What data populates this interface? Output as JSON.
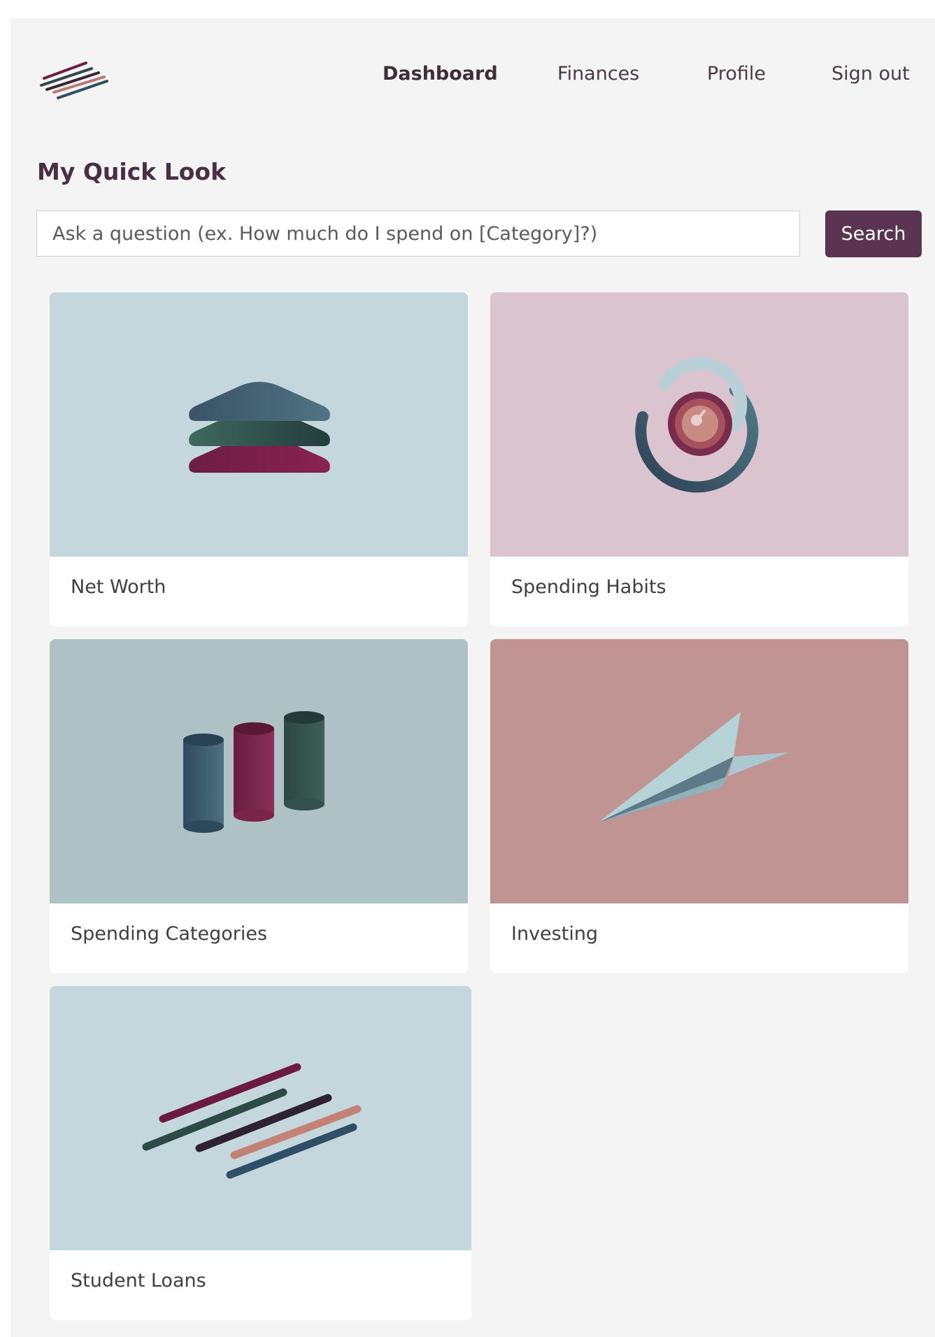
{
  "nav": {
    "dashboard": "Dashboard",
    "finances": "Finances",
    "profile": "Profile",
    "sign_out": "Sign out"
  },
  "page": {
    "title": "My Quick Look"
  },
  "search": {
    "placeholder": "Ask a question (ex. How much do I spend on [Category]?)",
    "button_label": "Search"
  },
  "cards": [
    {
      "label": "Net Worth",
      "icon": "layers-icon",
      "bg": "#c4d7dc"
    },
    {
      "label": "Spending Habits",
      "icon": "donut-icon",
      "bg": "#dac5cf"
    },
    {
      "label": "Spending Categories",
      "icon": "cylinders-icon",
      "bg": "#aec2c5"
    },
    {
      "label": "Investing",
      "icon": "paper-plane-icon",
      "bg": "#c19494"
    },
    {
      "label": "Student Loans",
      "icon": "stripes-icon",
      "bg": "#c4d7dc"
    }
  ],
  "colors": {
    "brand": "#5b3451",
    "page_bg": "#f4f4f4",
    "title": "#4a2f42"
  }
}
